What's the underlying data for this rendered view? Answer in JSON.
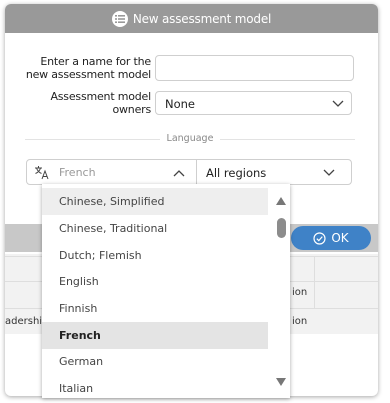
{
  "dialog": {
    "title": "New assessment model",
    "icon": "list-icon",
    "name_label_line1": "Enter a name for the",
    "name_label_line2": "new assessment model",
    "name_value": "",
    "owners_label_line1": "Assessment model",
    "owners_label_line2": "owners",
    "owners_value": "None",
    "language_section_label": "Language",
    "language_value": "French",
    "region_value": "All regions",
    "ok_label": "OK"
  },
  "background_table": {
    "row1": {
      "right_text": "ion"
    },
    "row2": {
      "left_text": "adership",
      "right_text": "ion"
    }
  },
  "language_dropdown": {
    "items": [
      "Chinese, Simplified",
      "Chinese, Traditional",
      "Dutch; Flemish",
      "English",
      "Finnish",
      "French",
      "German",
      "Italian"
    ],
    "hovered": "Chinese, Simplified",
    "selected": "French"
  },
  "colors": {
    "titlebar": "#999999",
    "ok_button": "#3f82c7",
    "band": "#c8c8c8"
  }
}
